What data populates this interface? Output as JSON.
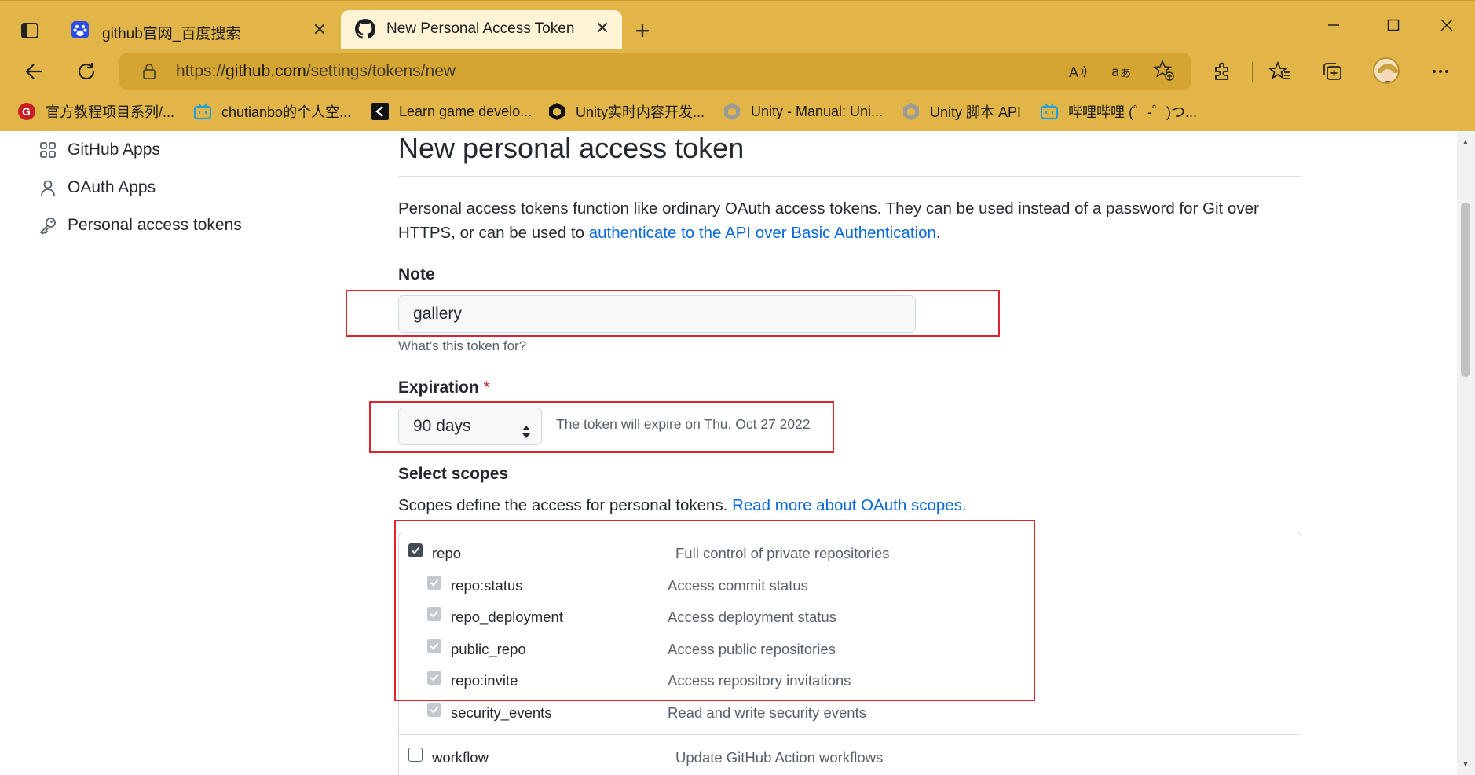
{
  "browser": {
    "tabs": [
      {
        "title": "github官网_百度搜索",
        "favicon": "baidu-paw-icon"
      },
      {
        "title": "New Personal Access Token",
        "favicon": "github-octocat-icon"
      }
    ],
    "new_tab_symbol": "+",
    "address": {
      "scheme": "https://",
      "host": "github.com",
      "path": "/settings/tokens/new"
    },
    "bookmarks": [
      {
        "label": "官方教程项目系列/...",
        "icon": "gitee-icon"
      },
      {
        "label": "chutianbo的个人空...",
        "icon": "bilibili-tv-icon"
      },
      {
        "label": "Learn game develo...",
        "icon": "unity-learn-icon"
      },
      {
        "label": "Unity实时内容开发...",
        "icon": "unity-cube-icon"
      },
      {
        "label": "Unity - Manual: Uni...",
        "icon": "unity-cube-icon"
      },
      {
        "label": "Unity 脚本 API",
        "icon": "unity-cube-icon"
      },
      {
        "label": "哔哩哔哩 (゜-゜)つ...",
        "icon": "bilibili-tv-icon"
      }
    ],
    "colors": {
      "chrome": "#e2b548",
      "address_bar": "#d5a534"
    }
  },
  "sidebar": {
    "items": [
      {
        "label": "GitHub Apps",
        "icon": "apps-grid-icon"
      },
      {
        "label": "OAuth Apps",
        "icon": "person-icon"
      },
      {
        "label": "Personal access tokens",
        "icon": "key-icon"
      }
    ]
  },
  "main": {
    "title": "New personal access token",
    "intro_text": "Personal access tokens function like ordinary OAuth access tokens. They can be used instead of a password for Git over HTTPS, or can be used to ",
    "intro_link": "authenticate to the API over Basic Authentication",
    "intro_end": ".",
    "note": {
      "label": "Note",
      "value": "gallery",
      "hint": "What’s this token for?"
    },
    "expiration": {
      "label": "Expiration",
      "required_mark": "*",
      "selected": "90 days",
      "expire_text": "The token will expire on Thu, Oct 27 2022"
    },
    "scopes": {
      "heading": "Select scopes",
      "desc": "Scopes define the access for personal tokens. ",
      "desc_link": "Read more about OAuth scopes.",
      "items": [
        {
          "name": "repo",
          "desc": "Full control of private repositories",
          "checked": true
        },
        {
          "name": "repo:status",
          "desc": "Access commit status",
          "checked": true
        },
        {
          "name": "repo_deployment",
          "desc": "Access deployment status",
          "checked": true
        },
        {
          "name": "public_repo",
          "desc": "Access public repositories",
          "checked": true
        },
        {
          "name": "repo:invite",
          "desc": "Access repository invitations",
          "checked": true
        },
        {
          "name": "security_events",
          "desc": "Read and write security events",
          "checked": true
        },
        {
          "name": "workflow",
          "desc": "Update GitHub Action workflows",
          "checked": false
        }
      ]
    }
  },
  "annotation_color": "#e0242f"
}
